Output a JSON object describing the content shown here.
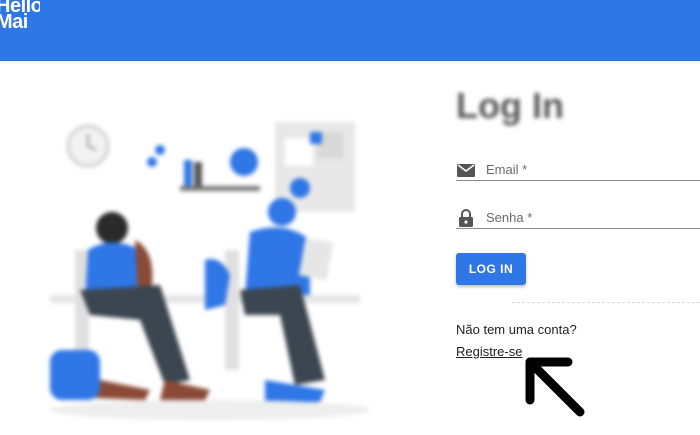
{
  "header": {
    "logo_line1": "Hello",
    "logo_line2": "Mai"
  },
  "login": {
    "title": "Log In",
    "email_label": "Email *",
    "password_label": "Senha *",
    "submit_label": "LOG IN"
  },
  "signup": {
    "question": "Não tem uma conta?",
    "link_label": "Registre-se"
  },
  "icons": {
    "email": "envelope-icon",
    "password": "lock-icon",
    "pointer": "arrow-pointer-icon"
  },
  "colors": {
    "primary": "#2f76e6",
    "text": "#222222",
    "muted": "#6b6b6b"
  }
}
